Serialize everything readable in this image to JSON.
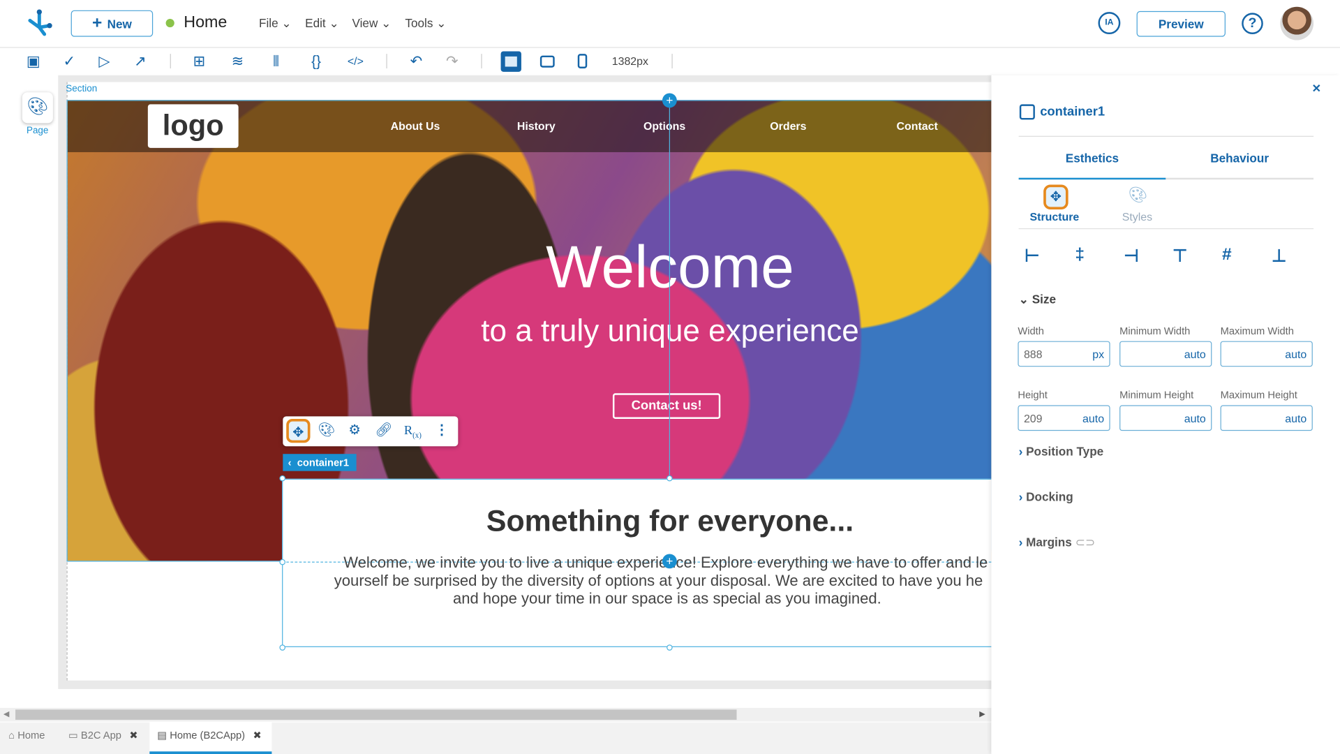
{
  "header": {
    "new_label": "New",
    "page_title": "Home",
    "status_color": "#8bc34a",
    "menus": [
      "File",
      "Edit",
      "View",
      "Tools"
    ],
    "ia_label": "IA",
    "preview_label": "Preview"
  },
  "toolbar": {
    "width_readout": "1382px"
  },
  "left_rail": {
    "page_label": "Page"
  },
  "canvas": {
    "section_label": "Section",
    "logo_text": "logo",
    "nav_items": [
      "About Us",
      "History",
      "Options",
      "Orders",
      "Contact"
    ],
    "hero_title": "Welcome",
    "hero_subtitle": "to a truly unique experience",
    "cta_label": "Contact us!",
    "selected_tag": "container1",
    "content_heading": "Something for everyone...",
    "content_lines": [
      "Welcome, we invite you to live a unique experience! Explore everything we have to offer and le",
      "yourself be surprised by the diversity of options at your disposal. We are excited to have you he",
      "and hope your time in our space is as special as you imagined."
    ]
  },
  "panel": {
    "component_name": "container1",
    "tabs": [
      "Esthetics",
      "Behaviour"
    ],
    "subtabs": [
      "Structure",
      "Styles"
    ],
    "size_section": "Size",
    "fields": [
      {
        "label": "Width",
        "value": "888",
        "unit": "px"
      },
      {
        "label": "Minimum Width",
        "value": "",
        "unit": "auto"
      },
      {
        "label": "Maximum Width",
        "value": "",
        "unit": "auto"
      },
      {
        "label": "Height",
        "value": "209",
        "unit": "auto"
      },
      {
        "label": "Minimum Height",
        "value": "",
        "unit": "auto"
      },
      {
        "label": "Maximum Height",
        "value": "",
        "unit": "auto"
      }
    ],
    "sections": [
      "Position Type",
      "Docking",
      "Margins"
    ]
  },
  "bottom_tabs": [
    {
      "label": "Home"
    },
    {
      "label": "B2C App"
    },
    {
      "label": "Home (B2CApp)"
    }
  ],
  "accent": "#1565a8"
}
